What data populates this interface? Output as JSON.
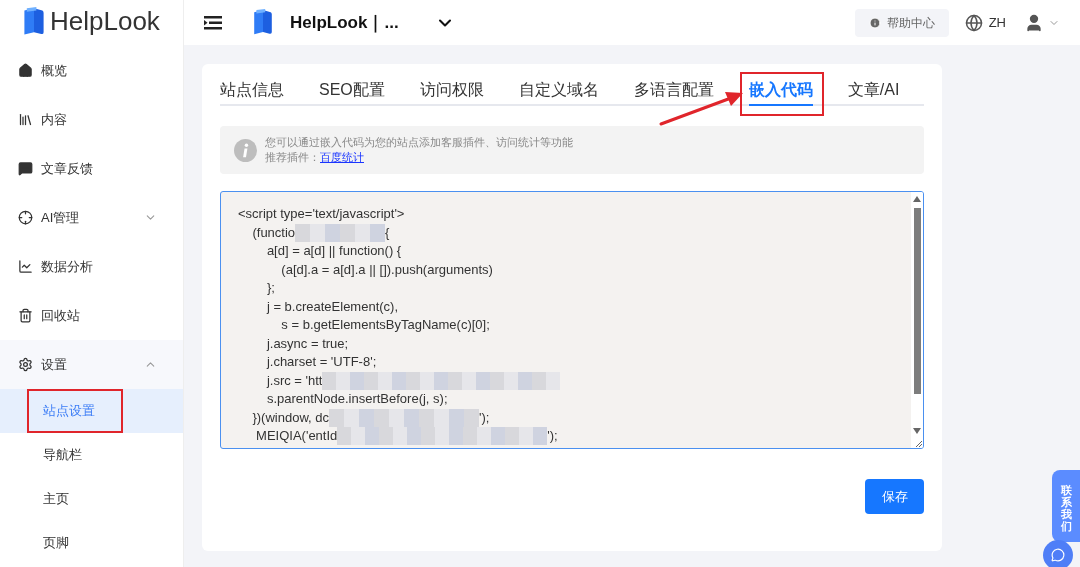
{
  "brand": {
    "name": "HelpLook"
  },
  "header": {
    "site_title": "HelpLook｜...",
    "help": "帮助中心",
    "language": "ZH"
  },
  "sidebar": {
    "items": [
      {
        "label": "概览"
      },
      {
        "label": "内容"
      },
      {
        "label": "文章反馈"
      },
      {
        "label": "AI管理",
        "expanded": false
      },
      {
        "label": "数据分析"
      },
      {
        "label": "回收站"
      },
      {
        "label": "设置",
        "expanded": true,
        "children": [
          {
            "label": "站点设置",
            "selected": true,
            "highlighted": true
          },
          {
            "label": "导航栏",
            "selected": false,
            "highlighted": false
          },
          {
            "label": "主页",
            "selected": false,
            "highlighted": false
          },
          {
            "label": "页脚",
            "selected": false,
            "highlighted": false
          }
        ]
      }
    ]
  },
  "tabs": [
    {
      "label": "站点信息",
      "selected": false,
      "highlighted": false
    },
    {
      "label": "SEO配置",
      "selected": false,
      "highlighted": false
    },
    {
      "label": "访问权限",
      "selected": false,
      "highlighted": false
    },
    {
      "label": "自定义域名",
      "selected": false,
      "highlighted": false
    },
    {
      "label": "多语言配置",
      "selected": false,
      "highlighted": false
    },
    {
      "label": "嵌入代码",
      "selected": true,
      "highlighted": true
    },
    {
      "label": "文章/AI",
      "selected": false,
      "highlighted": false
    }
  ],
  "notice": {
    "text": "您可以通过嵌入代码为您的站点添加客服插件、访问统计等功能",
    "recommend_label": "推荐插件：",
    "recommend_link": "百度统计"
  },
  "code_lines": [
    {
      "text": "<script type='text/javascript'>",
      "redacted": false
    },
    {
      "text": "    (functio",
      "redacted": true,
      "after": "{"
    },
    {
      "text": "        a[d] = a[d] || function() {",
      "redacted": false
    },
    {
      "text": "            (a[d].a = a[d].a || []).push(arguments)",
      "redacted": false
    },
    {
      "text": "        };",
      "redacted": false
    },
    {
      "text": "        j = b.createElement(c),",
      "redacted": false
    },
    {
      "text": "            s = b.getElementsByTagName(c)[0];",
      "redacted": false
    },
    {
      "text": "        j.async = true;",
      "redacted": false
    },
    {
      "text": "        j.charset = 'UTF-8';",
      "redacted": false
    },
    {
      "text": "        j.src = 'htt",
      "redacted": true
    },
    {
      "text": "        s.parentNode.insertBefore(j, s);",
      "redacted": false
    },
    {
      "text": "    })(window, dc",
      "redacted": true,
      "after": "');"
    },
    {
      "text": "     MEIQIA('entId",
      "redacted": true,
      "after": "');"
    }
  ],
  "save_button": "保存",
  "contact_tab": "联系我们"
}
